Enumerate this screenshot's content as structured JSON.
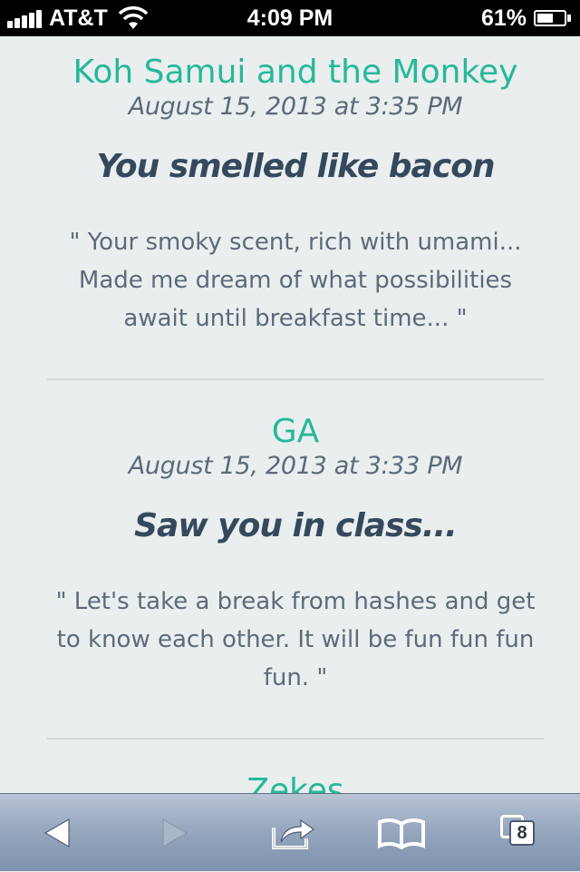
{
  "status_bar": {
    "carrier": "AT&T",
    "time": "4:09 PM",
    "battery_percent": "61%",
    "battery_level": 0.61
  },
  "posts": [
    {
      "author": "Koh Samui and the Monkey",
      "date": "August 15, 2013 at 3:35 PM",
      "title": "You smelled like bacon",
      "body": "\" Your smoky scent, rich with umami... Made me dream of what possibilities await until breakfast time... \""
    },
    {
      "author": "GA",
      "date": "August 15, 2013 at 3:33 PM",
      "title": "Saw you in class...",
      "body": "\" Let's take a break from hashes and get to know each other. It will be fun fun fun fun. \""
    },
    {
      "author": "Zekes"
    }
  ],
  "toolbar": {
    "back_icon": "back-arrow-icon",
    "forward_icon": "forward-arrow-icon",
    "share_icon": "share-icon",
    "bookmarks_icon": "bookmarks-icon",
    "tabs_icon": "tabs-icon",
    "tabs_count": "8"
  },
  "colors": {
    "accent": "#26b89a",
    "title": "#34495e",
    "text": "#5c6b7a",
    "background": "#eaeeee"
  }
}
